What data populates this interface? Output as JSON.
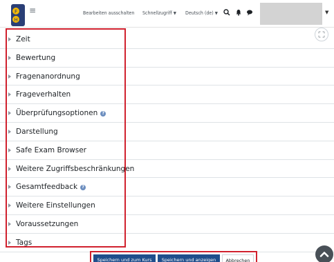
{
  "navbar": {
    "edit_toggle": "Bearbeiten ausschalten",
    "quick_access": "Schnellzugriff",
    "language": "Deutsch (de)",
    "logo_letters": [
      "F",
      "H"
    ],
    "icons": [
      "menu-icon",
      "search-icon",
      "bell-icon",
      "chat-icon"
    ]
  },
  "sections": [
    {
      "label": "Zeit",
      "help": false
    },
    {
      "label": "Bewertung",
      "help": false
    },
    {
      "label": "Fragenanordnung",
      "help": false
    },
    {
      "label": "Frageverhalten",
      "help": false
    },
    {
      "label": "Überprüfungsoptionen",
      "help": true
    },
    {
      "label": "Darstellung",
      "help": false
    },
    {
      "label": "Safe Exam Browser",
      "help": false
    },
    {
      "label": "Weitere Zugriffsbeschränkungen",
      "help": false
    },
    {
      "label": "Gesamtfeedback",
      "help": true
    },
    {
      "label": "Weitere Einstellungen",
      "help": false
    },
    {
      "label": "Voraussetzungen",
      "help": false
    },
    {
      "label": "Tags",
      "help": false
    }
  ],
  "buttons": {
    "save_course": "Speichern und zum Kurs",
    "save_show": "Speichern und anzeigen",
    "cancel": "Abbrechen"
  },
  "colors": {
    "highlight": "#d0202d",
    "primary": "#1f4e8c",
    "help": "#6c8ebf"
  }
}
